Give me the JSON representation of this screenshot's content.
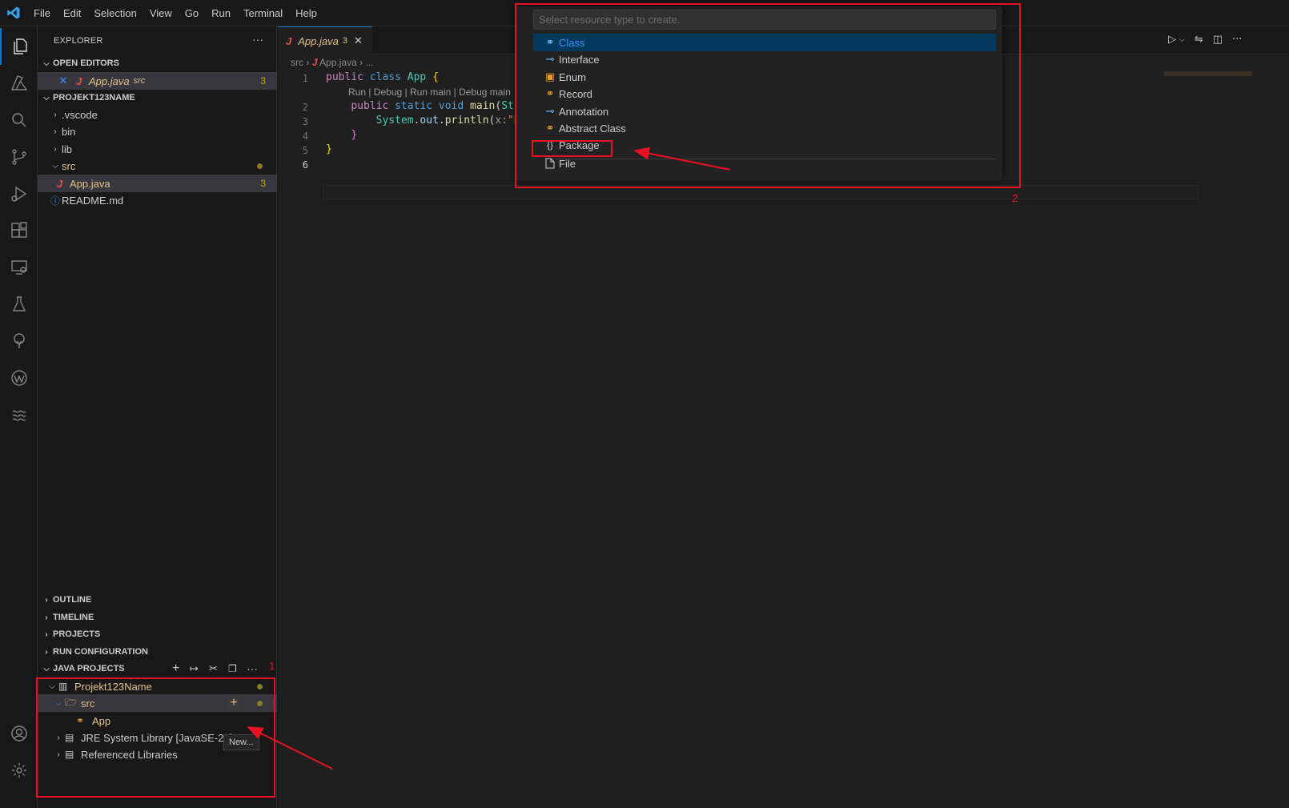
{
  "menu": [
    "File",
    "Edit",
    "Selection",
    "View",
    "Go",
    "Run",
    "Terminal",
    "Help"
  ],
  "explorer": {
    "title": "EXPLORER",
    "more": "···",
    "open_editors_label": "OPEN EDITORS",
    "open_editor_file": "App.java",
    "open_editor_folder": "src",
    "open_editor_badge": "3",
    "project_label": "PROJEKT123NAME",
    "tree": {
      "vscode": ".vscode",
      "bin": "bin",
      "lib": "lib",
      "src": "src",
      "app": "App.java",
      "app_badge": "3",
      "readme": "README.md"
    },
    "sections": {
      "outline": "OUTLINE",
      "timeline": "TIMELINE",
      "projects": "PROJECTS",
      "run_config": "RUN CONFIGURATION",
      "java_projects": "JAVA PROJECTS"
    },
    "java_projects": {
      "project": "Projekt123Name",
      "src": "src",
      "app": "App",
      "jre": "JRE System Library [JavaSE-25]",
      "ref_libs": "Referenced Libraries"
    }
  },
  "tooltip": "New...",
  "editor": {
    "tab_name": "App.java",
    "tab_badge": "3",
    "crumb_src": "src",
    "crumb_file": "App.java",
    "crumb_more": "...",
    "codelens": "Run | Debug | Run main | Debug main",
    "lines": [
      "1",
      "2",
      "3",
      "4",
      "5",
      "6"
    ]
  },
  "quickpick": {
    "placeholder": "Select resource type to create.",
    "items": [
      "Class",
      "Interface",
      "Enum",
      "Record",
      "Annotation",
      "Abstract Class",
      "Package",
      "File"
    ]
  },
  "annotations": {
    "label1": "1",
    "label2": "2"
  },
  "colors": {
    "accent": "#0078d4",
    "annotation": "#e81123",
    "modified": "#e2c08d",
    "quickpick_active": "#04395e"
  }
}
